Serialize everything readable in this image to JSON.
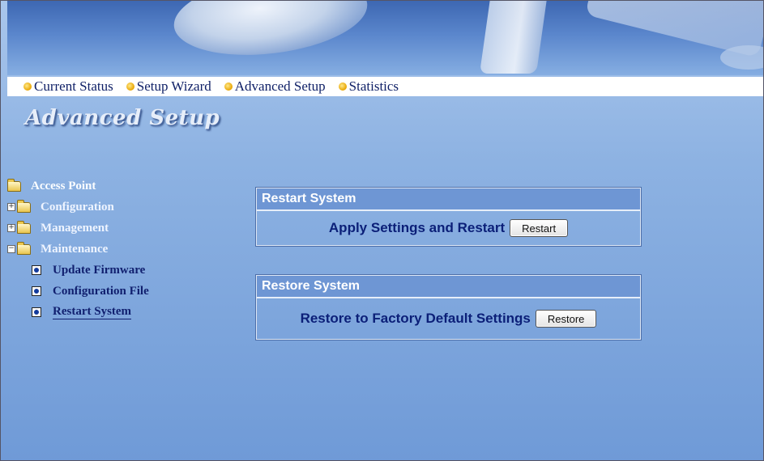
{
  "nav": {
    "items": [
      {
        "label": "Current Status"
      },
      {
        "label": "Setup Wizard"
      },
      {
        "label": "Advanced Setup"
      },
      {
        "label": "Statistics"
      }
    ]
  },
  "page_title": "Advanced Setup",
  "tree": {
    "root": "Access Point",
    "folders": [
      {
        "label": "Configuration",
        "expander": "+"
      },
      {
        "label": "Management",
        "expander": "+"
      },
      {
        "label": "Maintenance",
        "expander": "−"
      }
    ],
    "maintenance_items": [
      {
        "label": "Update Firmware"
      },
      {
        "label": "Configuration File"
      },
      {
        "label": "Restart System"
      }
    ]
  },
  "restart_panel": {
    "title": "Restart System",
    "text": "Apply Settings and Restart",
    "button": "Restart"
  },
  "restore_panel": {
    "title": "Restore System",
    "text": "Restore to Factory Default Settings",
    "button": "Restore"
  },
  "colors": {
    "panel_header": "#6e96d4",
    "nav_dot": "#e8a400",
    "label_text": "#0b1f78"
  }
}
